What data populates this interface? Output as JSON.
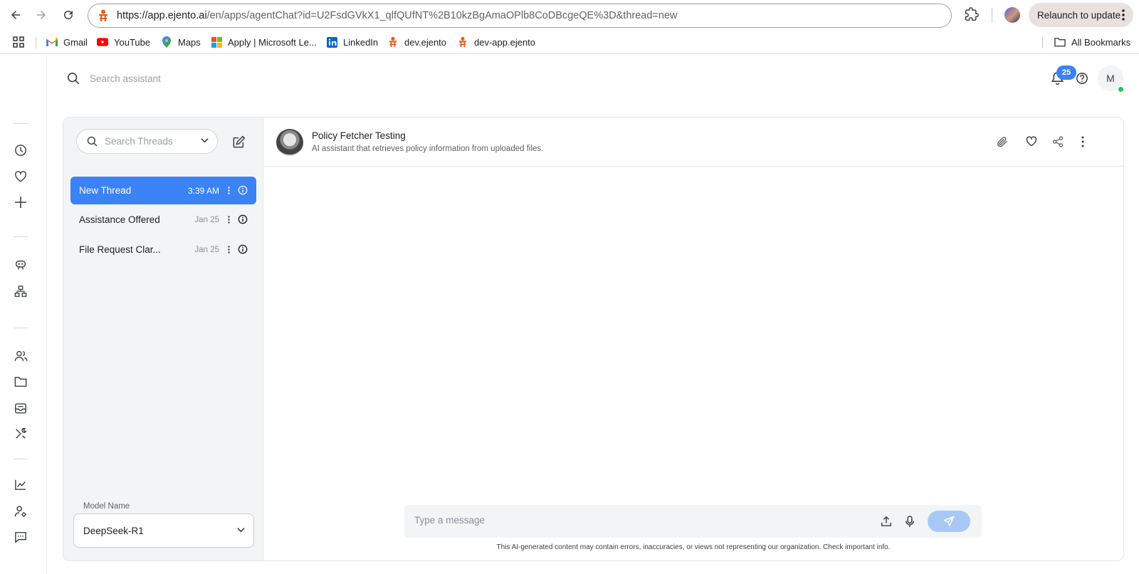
{
  "browser": {
    "url_host": "https://app.ejento.ai",
    "url_path": "/en/apps/agentChat?id=U2FsdGVkX1_qlfQUfNT%2B10kzBgAmaOPlb8CoDBcgeQE%3D&thread=new",
    "relaunch_label": "Relaunch to update"
  },
  "bookmarks": {
    "items": [
      {
        "label": "Gmail",
        "icon": "gmail-icon"
      },
      {
        "label": "YouTube",
        "icon": "youtube-icon"
      },
      {
        "label": "Maps",
        "icon": "maps-icon"
      },
      {
        "label": "Apply | Microsoft Le...",
        "icon": "microsoft-icon"
      },
      {
        "label": "LinkedIn",
        "icon": "linkedin-icon"
      },
      {
        "label": "dev.ejento",
        "icon": "ejento-icon"
      },
      {
        "label": "dev-app.ejento",
        "icon": "ejento-icon"
      }
    ],
    "all_bookmarks": "All Bookmarks"
  },
  "topbar": {
    "search_placeholder": "Search assistant",
    "notification_count": "25",
    "avatar_initial": "M"
  },
  "threads": {
    "search_placeholder": "Search Threads",
    "items": [
      {
        "title": "New Thread",
        "date": "3:39 AM",
        "active": true
      },
      {
        "title": "Assistance Offered",
        "date": "Jan 25",
        "active": false
      },
      {
        "title": "File Request Clar...",
        "date": "Jan 25",
        "active": false
      }
    ],
    "model_label": "Model Name",
    "model_value": "DeepSeek-R1"
  },
  "chat": {
    "agent_name": "Policy Fetcher Testing",
    "agent_description": "AI assistant that retrieves policy information from uploaded files.",
    "input_placeholder": "Type a message",
    "disclaimer": "This AI-generated content may contain errors, inaccuracies, or views not representing our organization. Check important info."
  },
  "colors": {
    "accent": "#3b82f6",
    "brand": "#f05a1a",
    "online": "#22c55e"
  }
}
